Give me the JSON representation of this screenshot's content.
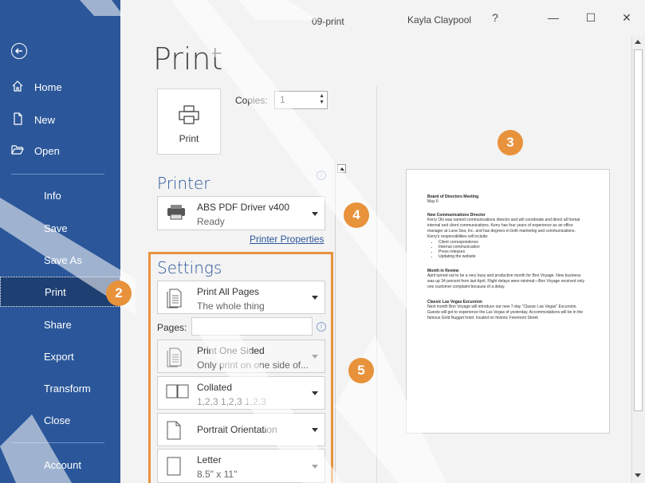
{
  "window": {
    "title": "09-print",
    "user": "Kayla Claypool",
    "help": "?",
    "minimize": "—",
    "maximize": "☐",
    "close": "✕"
  },
  "nav": {
    "items": [
      {
        "label": "Home",
        "icon": "home-icon"
      },
      {
        "label": "New",
        "icon": "new-document-icon"
      },
      {
        "label": "Open",
        "icon": "folder-open-icon"
      },
      {
        "label": "Info"
      },
      {
        "label": "Save"
      },
      {
        "label": "Save As"
      },
      {
        "label": "Print",
        "active": true
      },
      {
        "label": "Share"
      },
      {
        "label": "Export"
      },
      {
        "label": "Transform"
      },
      {
        "label": "Close"
      },
      {
        "label": "Account"
      }
    ]
  },
  "page": {
    "title": "Print",
    "print_button": "Print",
    "copies_label": "Copies:",
    "copies_value": "1"
  },
  "printer": {
    "section_title": "Printer",
    "name": "ABS PDF Driver v400",
    "status": "Ready",
    "properties_link": "Printer Properties"
  },
  "settings": {
    "section_title": "Settings",
    "pages_label": "Pages:",
    "pages_value": "",
    "range": {
      "main": "Print All Pages",
      "sub": "The whole thing"
    },
    "sides": {
      "main": "Print One Sided",
      "sub": "Only print on one side of..."
    },
    "collation": {
      "main": "Collated",
      "sub": "1,2,3   1,2,3   1,2,3"
    },
    "orientation": {
      "main": "Portrait Orientation"
    },
    "paper": {
      "main": "Letter",
      "sub": "8.5\" x 11\""
    }
  },
  "preview": {
    "heading": "Board of Directors Meeting",
    "date": "May 6",
    "sections": [
      {
        "title": "New Communications Director",
        "body": "Kerry Oki was named communications director and will coordinate and direct all formal internal and client communications. Kerry has four years of experience as an office manager at Luna Sea, Inc. and has degrees in both marketing and communications. Kerry's responsibilities will include:",
        "bullets": [
          "Client correspondence",
          "Internal communication",
          "Press releases",
          "Updating the website"
        ]
      },
      {
        "title": "Month in Review",
        "body": "April turned out to be a very busy and productive month for Bon Voyage. New business was up 34 percent from last April. Flight delays were minimal—Bon Voyage received only one customer complaint because of a delay.",
        "bullets": []
      },
      {
        "title": "Classic Las Vegas Excursion",
        "body": "Next month Bon Voyage will introduce our new 7-day \"Classic Las Vegas\" Excursion. Guests will get to experience the Las Vegas of yesterday. Accommodations will be in the famous Gold Nugget hotel, located on historic Freemont Street.",
        "bullets": []
      }
    ]
  },
  "callouts": [
    "2",
    "3",
    "4",
    "5"
  ],
  "colors": {
    "nav_bg": "#2b579a",
    "accent": "#e8923c",
    "nav_active": "#1e3f72"
  }
}
